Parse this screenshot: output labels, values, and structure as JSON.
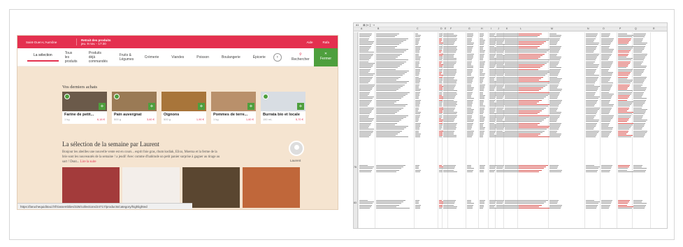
{
  "shop": {
    "topbar": {
      "location": "Saint-Ouen-L'Aumône",
      "pickup_title": "Retrait des produits",
      "pickup_time": "jeu. 9 nov. - 17:30",
      "help": "Aide",
      "user": "Rafa"
    },
    "nav": {
      "tabs": [
        "La sélection",
        "Tous les produits",
        "Produits déjà commandés",
        "Fruits & Légumes",
        "Crèmerie",
        "Viandes",
        "Poisson",
        "Boulangerie",
        "Épicerie"
      ],
      "arrow": "›",
      "search_icon": "⚲",
      "search_label": "Rechercher",
      "close_label": "Fermer"
    },
    "recent_title": "Vos derniers achats",
    "recent": [
      {
        "name": "Farine de petit...",
        "qty": "1 kg",
        "price": "6,18 €",
        "color": "#6b5a4a"
      },
      {
        "name": "Pain auvergnat",
        "qty": "500 g",
        "price": "3,60 €",
        "color": "#9a7a55"
      },
      {
        "name": "Oignons",
        "qty": "500 g",
        "price": "1,90 €",
        "color": "#a8753a"
      },
      {
        "name": "Pommes de terre...",
        "qty": "1 kg",
        "price": "1,60 €",
        "color": "#b9906b"
      },
      {
        "name": "Burrata bio et locale",
        "qty": "150 mL",
        "price": "5,70 €",
        "color": "#d8dde3"
      }
    ],
    "weekly_title": "La sélection de la semaine par Laurent",
    "weekly_text": "Bonjour les abeilles une nouvelle vente est en cours... esprit foie gras, rhum kodiak, Elixo, Moerna et la ferme de la brie sont les nouveautés de la semaine ! a jeudi! Avec comme d'habitude un petit panier surprise à gagner au tirage au sort ! Dont...",
    "weekly_more": "Lire la suite",
    "author": "Laurent",
    "photos": [
      "#a33b3b",
      "#f3eeea",
      "#5a4630",
      "#c0673a"
    ],
    "status_url": "https://laruchequiditoui.fr/fr/assemblies/328/collections/24717/products/category/highlighted"
  },
  "sheet": {
    "cell_ref": "A1",
    "columns": [
      "A",
      "B",
      "C",
      "D",
      "E",
      "F",
      "G",
      "H",
      "I",
      "J",
      "K",
      "L",
      "M",
      "N",
      "O",
      "P",
      "Q",
      "R"
    ],
    "row_labels": [
      "78",
      "83"
    ]
  }
}
